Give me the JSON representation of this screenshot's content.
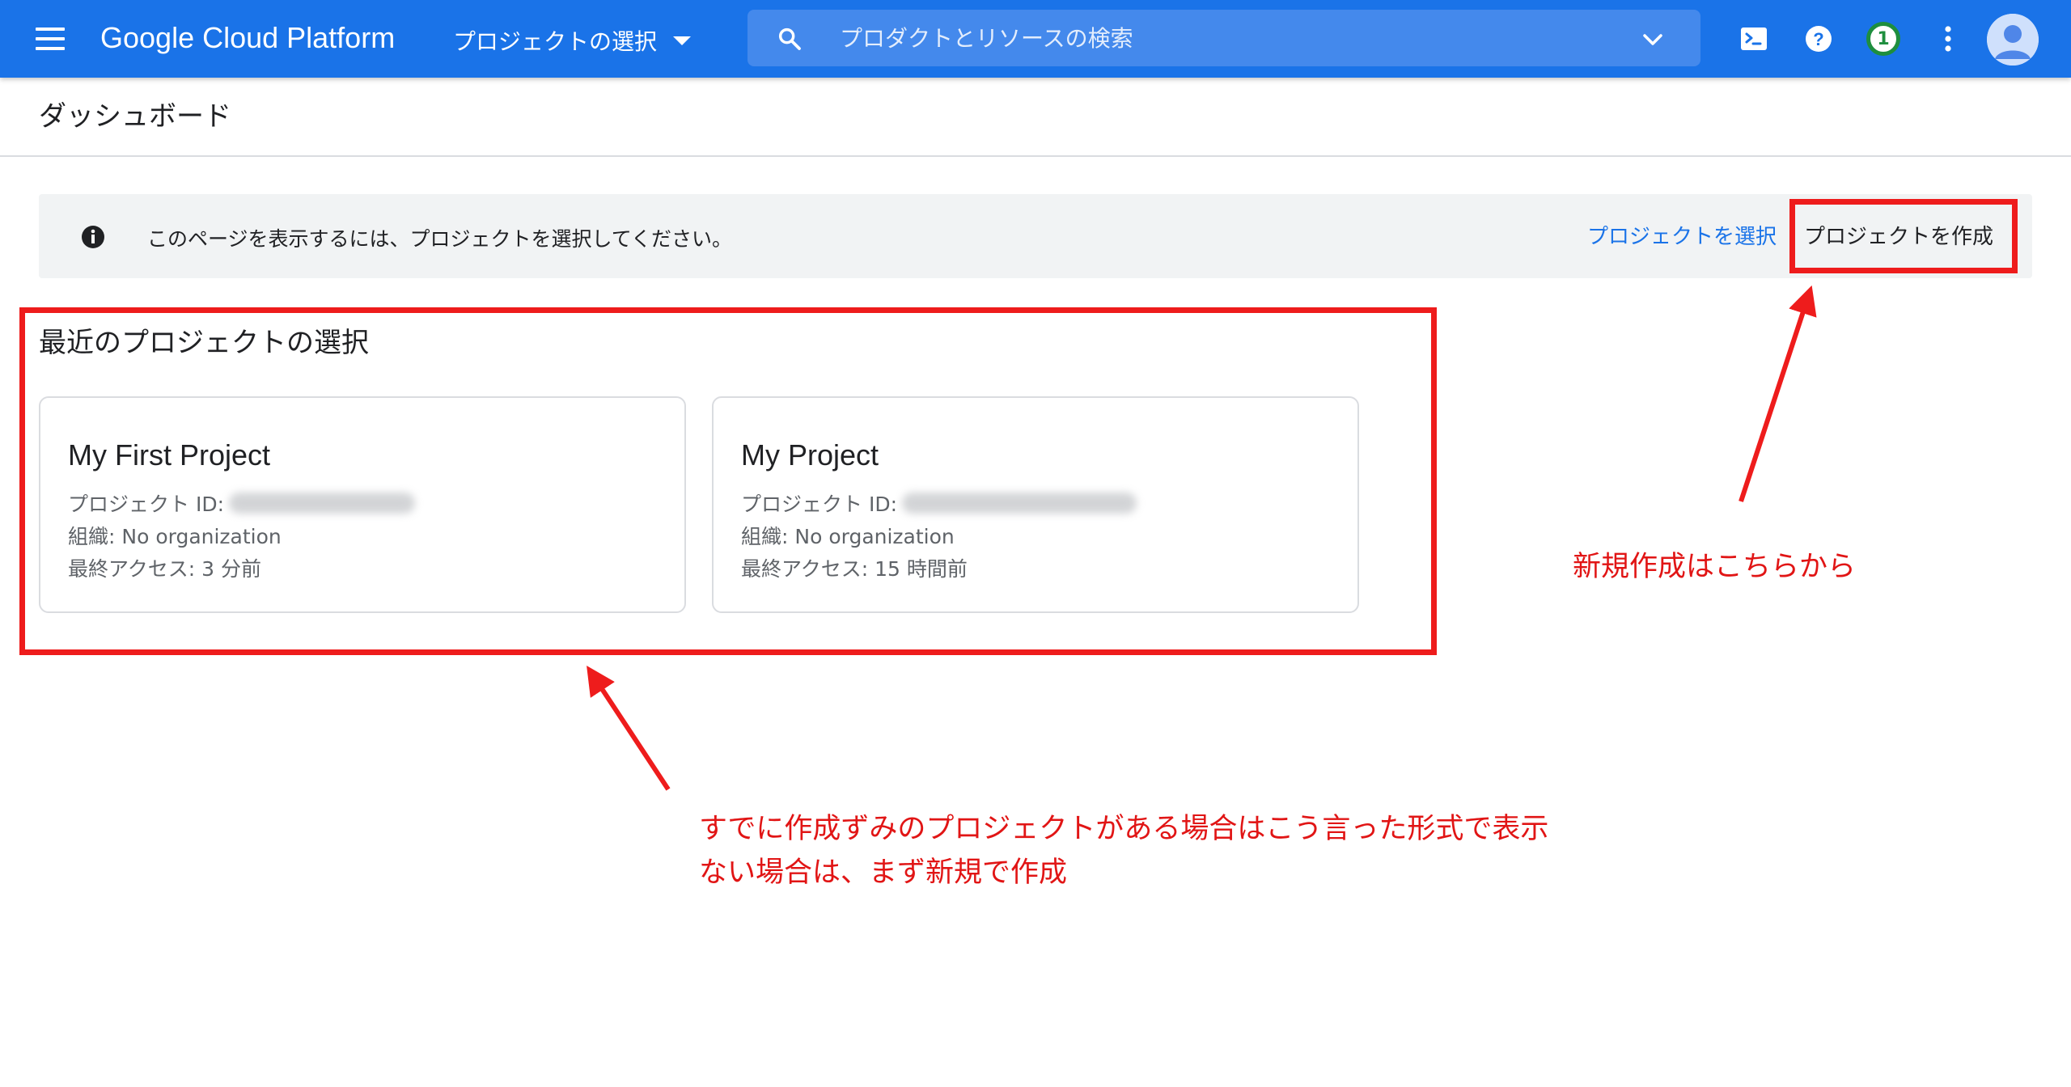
{
  "topbar": {
    "brand": "Google Cloud Platform",
    "project_picker_label": "プロジェクトの選択",
    "search_placeholder": "プロダクトとリソースの検索",
    "notification_count": "1",
    "accent_color": "#1a73e8"
  },
  "header": {
    "title": "ダッシュボード"
  },
  "banner": {
    "message": "このページを表示するには、プロジェクトを選択してください。",
    "select_label": "プロジェクトを選択",
    "create_label": "プロジェクトを作成"
  },
  "recent": {
    "title": "最近のプロジェクトの選択",
    "projects": [
      {
        "name": "My First Project",
        "id_label": "プロジェクト ID:",
        "org": "組織: No organization",
        "last_access": "最終アクセス: 3 分前"
      },
      {
        "name": "My Project",
        "id_label": "プロジェクト ID:",
        "org": "組織: No organization",
        "last_access": "最終アクセス: 15 時間前"
      }
    ]
  },
  "annotations": {
    "create_note": "新規作成はこちらから",
    "recent_note_line1": "すでに作成ずみのプロジェクトがある場合はこう言った形式で表示",
    "recent_note_line2": "ない場合は、まず新規で作成",
    "color": "#ee1c1c"
  }
}
